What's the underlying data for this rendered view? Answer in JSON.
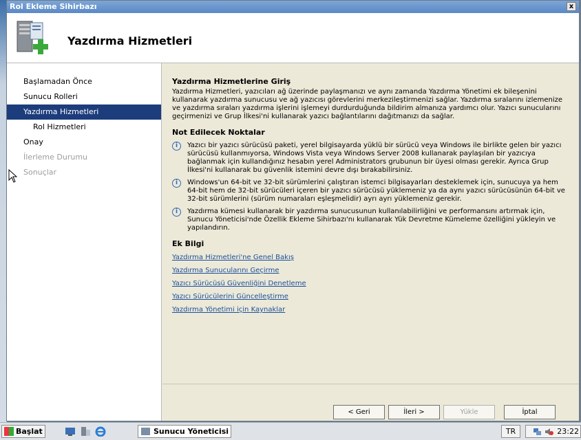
{
  "window": {
    "title": "Rol Ekleme Sihirbazı",
    "close_label": "x"
  },
  "header": {
    "title": "Yazdırma Hizmetleri",
    "icon": "server-add-icon"
  },
  "sidebar": {
    "items": [
      {
        "label": "Başlamadan Önce",
        "state": "normal"
      },
      {
        "label": "Sunucu Rolleri",
        "state": "normal"
      },
      {
        "label": "Yazdırma Hizmetleri",
        "state": "active"
      },
      {
        "label": "Rol Hizmetleri",
        "state": "sub"
      },
      {
        "label": "Onay",
        "state": "normal"
      },
      {
        "label": "İlerleme Durumu",
        "state": "disabled"
      },
      {
        "label": "Sonuçlar",
        "state": "disabled"
      }
    ]
  },
  "main": {
    "intro_title": "Yazdırma Hizmetlerine Giriş",
    "intro_text": "Yazdırma Hizmetleri, yazıcıları ağ üzerinde paylaşmanızı ve aynı zamanda Yazdırma Yönetimi ek bileşenini kullanarak yazdırma sunucusu ve ağ yazıcısı görevlerini merkezileştirmenizi sağlar. Yazdırma sıralarını izlemenize ve yazdırma sıraları yazdırma işlerini işlemeyi durdurduğunda bildirim almanıza yardımcı olur. Yazıcı sunucularını geçirmenizi ve Grup İlkesi'ni kullanarak yazıcı bağlantılarını dağıtmanızı da sağlar.",
    "notes_title": "Not Edilecek Noktalar",
    "notes": [
      "Yazıcı bir yazıcı sürücüsü paketi, yerel bilgisayarda yüklü bir sürücü veya  Windows ile birlikte gelen bir yazıcı sürücüsü kullanmıyorsa, Windows Vista veya Windows Server 2008 kullanarak paylaşılan bir yazıcıya bağlanmak için kullandığınız hesabın yerel Administrators grubunun bir üyesi olması gerekir. Ayrıca Grup İlkesi'ni kullanarak bu güvenlik istemini devre dışı bırakabilirsiniz.",
      "Windows'un 64-bit ve 32-bit sürümlerini çalıştıran istemci bilgisayarları desteklemek için, sunucuya ya hem 64-bit hem de 32-bit sürücüleri içeren bir yazıcı sürücüsü yüklemeniz ya da aynı yazıcı sürücüsünün 64-bit ve 32-bit sürümlerini (sürüm numaraları eşleşmelidir) ayrı ayrı yüklemeniz gerekir.",
      "Yazdırma kümesi kullanarak bir yazdırma sunucusunun kullanılabilirliğini ve performansını artırmak için, Sunucu Yöneticisi'nde Özellik Ekleme Sihirbazı'nı kullanarak Yük Devretme Kümeleme özelliğini yükleyin ve yapılandırın."
    ],
    "more_title": "Ek Bilgi",
    "links": [
      "Yazdırma Hizmetleri'ne Genel Bakış",
      "Yazdırma Sunucularını Geçirme",
      "Yazıcı Sürücüsü Güvenliğini Denetleme",
      "Yazıcı Sürücülerini Güncelleştirme",
      "Yazdırma Yönetimi için Kaynaklar"
    ]
  },
  "buttons": {
    "back": "< Geri",
    "next": "İleri >",
    "install": "Yükle",
    "cancel": "İptal"
  },
  "taskbar": {
    "start_label": "Başlat",
    "task_label": "Sunucu Yöneticisi",
    "lang": "TR",
    "clock": "23:22"
  }
}
